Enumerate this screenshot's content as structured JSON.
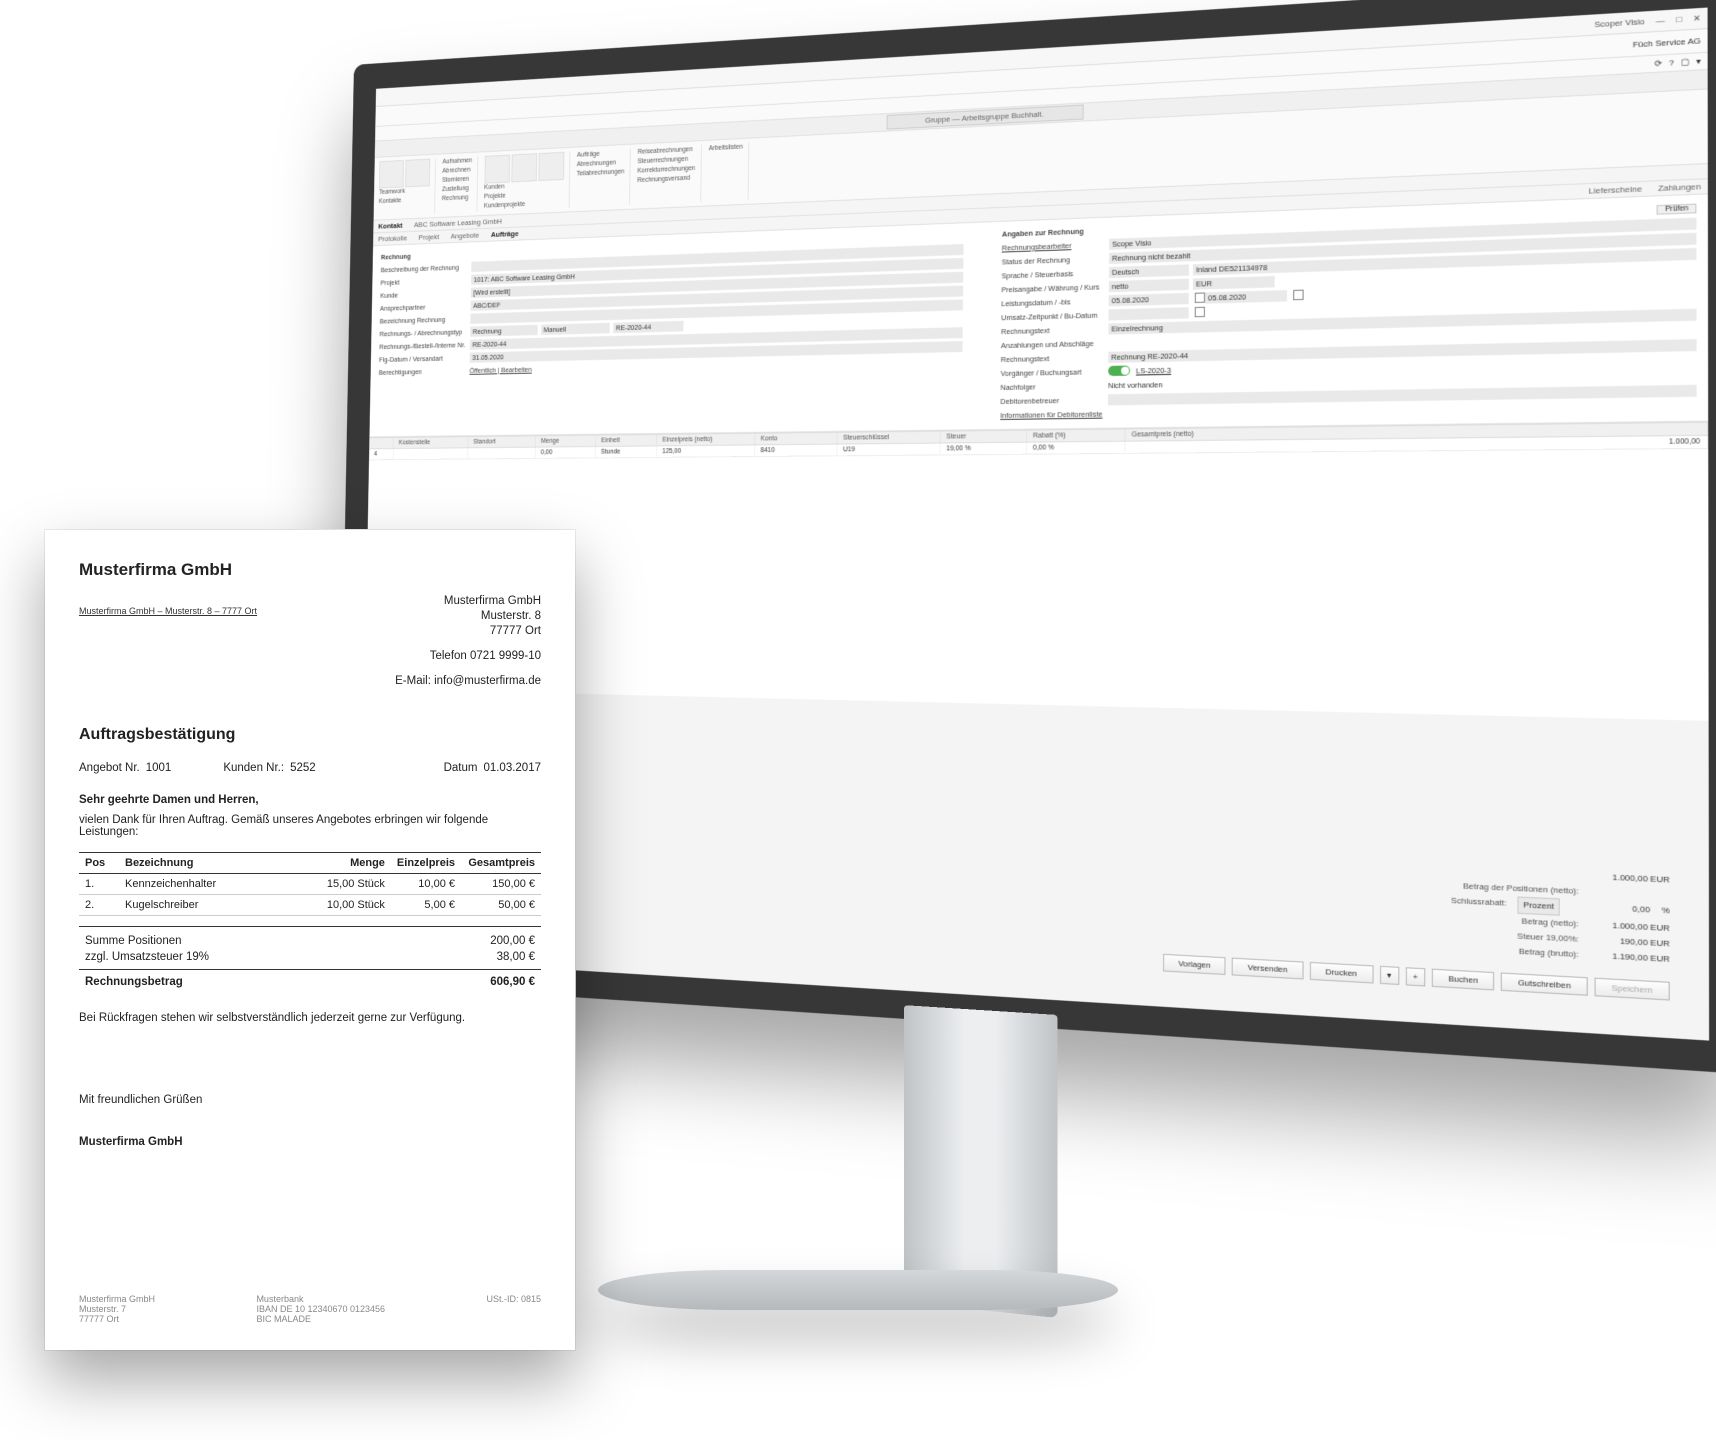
{
  "app": {
    "window_right": "Scoper Visio",
    "company": "Füch Service AG"
  },
  "breadcrumb": "Gruppe — Arbeitsgruppe Buchhalt.",
  "subtabs": {
    "kontakt": "Kontakt",
    "customer": "ABC Software Leasing GmbH"
  },
  "tabRow": [
    "Protokolle",
    "Projekt",
    "Angebote",
    "Aufträge",
    "Lieferscheine",
    "Zahlungen"
  ],
  "toolbarGroups": {
    "left1": [
      "Teamwork",
      "Kontakte"
    ],
    "mid": [
      "Aufnahmen",
      "Abrechnen",
      "Stornieren",
      "Zustellung",
      "Rechnung"
    ],
    "proj": [
      "Kunden",
      "Projekte",
      "Kundenprojekte"
    ],
    "right": [
      "Aufträge",
      "Abrechnungen",
      "Teilabrechnungen",
      "Reiseabrechnungen",
      "Steuerrechnungen",
      "Korrekturrechnungen",
      "Rechnungsversand",
      "Arbeitslisten"
    ]
  },
  "formLeft": {
    "section": "Rechnung",
    "l1": "Beschreibung der Rechnung",
    "l2": "Projekt",
    "v2": "1017: ABC Software Leasing GmbH",
    "l3": "Kunde",
    "v3": "[Wird erstellt]",
    "l4": "Ansprechpartner",
    "v4": "ABC/DEF",
    "l5": "Bezeichnung Rechnung",
    "l6": "Rechnungs- / Abrechnungstyp",
    "v6a": "RE-2020-44",
    "v6b": "Rechnung",
    "v6c": "Manuell",
    "v6d": "RE-2020-44",
    "l7": "Rechnungs-/Bestell-/Interne Nr.",
    "v7": "31.05.2020",
    "l8": "Flg-Datum / Versandart",
    "v8": "Öffentlich | Bearbeiten",
    "l9": "Berechtigungen"
  },
  "formRight": {
    "section": "Angaben zur Rechnung",
    "l1": "Rechnungsbearbeiter",
    "v1": "Scope Visio",
    "l2": "Status der Rechnung",
    "v2": "Rechnung nicht bezahlt",
    "l3": "Sprache / Steuerbasis",
    "v3a": "Deutsch",
    "v3b": "Inland DE521134978",
    "l4": "Preisangabe / Währung / Kurs",
    "v4a": "netto",
    "v4b": "EUR",
    "l5": "Leistungsdatum / -bis",
    "v5a": "05.08.2020",
    "v5b": "05.08.2020",
    "l6": "Umsatz-Zeitpunkt / Bu-Datum",
    "l7": "Rechnungstext",
    "v7": "Einzelrechnung",
    "l8": "Anzahlungen und Abschläge",
    "l9": "Rechnungstext",
    "v9": "Rechnung RE-2020-44",
    "l10": "Vorgänger / Buchungsart",
    "v10": "LS-2020-3",
    "l11": "Nachfolger",
    "v11": "Nicht vorhanden",
    "l12": "Debitorenbetreuer",
    "l13": "Informationen für Debitorenliste",
    "btn": "Prüfen"
  },
  "grid": {
    "headers": [
      "",
      "Kostenstelle",
      "Standort",
      "Menge",
      "Einheit",
      "Einzelpreis (netto)",
      "Konto",
      "Steuerschlüssel",
      "Steuer",
      "Rabatt (%)",
      "Gesamtpreis (netto)"
    ],
    "row": {
      "pos": "4",
      "menge": "0,00",
      "einheit": "Stunde",
      "ep": "125,00",
      "konto": "8410",
      "ss": "U19",
      "steuer": "19,00 %",
      "rabatt": "0,00 %",
      "gp": "1.000,00"
    }
  },
  "totals": {
    "l1": "Betrag der Positionen (netto):",
    "v0": "1.000,00 EUR",
    "l2": "Schlussrabatt:",
    "pill": "Prozent",
    "v2": "0,00",
    "pct": "%",
    "l3": "Betrag (netto):",
    "v3": "1.000,00 EUR",
    "l4": "Steuer 19,00%:",
    "v4": "190,00 EUR",
    "l5": "Betrag (brutto):",
    "v5": "1.190,00 EUR"
  },
  "footerButtons": [
    "Vorlagen",
    "Versenden",
    "Drucken",
    "Buchen",
    "Gutschreiben",
    "Speichern"
  ],
  "doc": {
    "company": "Musterfirma GmbH",
    "senderLine": "Musterfirma GmbH – Musterstr. 8 – 7777 Ort",
    "addr1": "Musterfirma GmbH",
    "addr2": "Musterstr. 8",
    "addr3": "77777 Ort",
    "tel": "Telefon 0721 9999-10",
    "email": "E-Mail: info@musterfirma.de",
    "title": "Auftragsbestätigung",
    "meta": {
      "l1": "Angebot Nr.",
      "v1": "1001",
      "l2": "Kunden Nr.:",
      "v2": "5252",
      "l3": "Datum",
      "v3": "01.03.2017"
    },
    "salutation": "Sehr geehrte Damen und Herren,",
    "intro": "vielen Dank für Ihren Auftrag. Gemäß unseres Angebotes erbringen wir folgende Leistungen:",
    "th": {
      "pos": "Pos",
      "bez": "Bezeichnung",
      "menge": "Menge",
      "ep": "Einzelpreis",
      "gp": "Gesamtpreis"
    },
    "rows": [
      {
        "pos": "1.",
        "bez": "Kennzeichenhalter",
        "menge": "15,00 Stück",
        "ep": "10,00 €",
        "gp": "150,00 €"
      },
      {
        "pos": "2.",
        "bez": "Kugelschreiber",
        "menge": "10,00 Stück",
        "ep": "5,00  €",
        "gp": "50,00  €"
      }
    ],
    "sum1l": "Summe Positionen",
    "sum1v": "200,00 €",
    "sum2l": "zzgl. Umsatzsteuer 19%",
    "sum2v": "38,00 €",
    "sum3l": "Rechnungsbetrag",
    "sum3v": "606,90 €",
    "outro": "Bei Rückfragen stehen wir selbstverständlich jederzeit gerne zur Verfügung.",
    "closing": "Mit freundlichen Grüßen",
    "sign": "Musterfirma GmbH",
    "foot": {
      "c1a": "Musterfirma GmbH",
      "c1b": "Musterstr. 7",
      "c1c": "77777 Ort",
      "c2a": "Musterbank",
      "c2b": "IBAN DE 10 12340670 0123456",
      "c2c": "BIC MALADE",
      "c3": "USt.-ID: 0815"
    }
  }
}
